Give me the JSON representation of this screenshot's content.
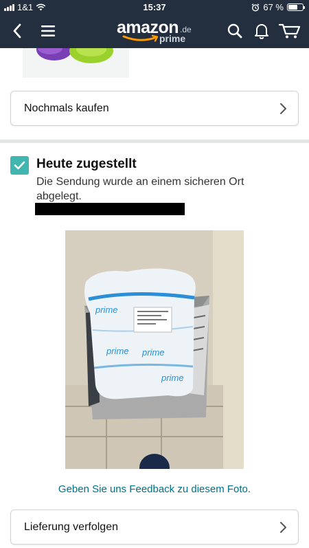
{
  "status_bar": {
    "carrier": "1&1",
    "time": "15:37",
    "battery_text": "67 %",
    "battery_level": 0.67,
    "icons": [
      "signal-icon",
      "wifi-icon",
      "alarm-icon",
      "battery-icon"
    ]
  },
  "nav": {
    "logo_main": "amazon",
    "logo_suffix": ".de",
    "logo_sub": "prime",
    "icons": [
      "back-icon",
      "menu-icon",
      "search-icon",
      "bell-icon",
      "cart-icon"
    ]
  },
  "buy_again": {
    "label": "Nochmals kaufen"
  },
  "delivery": {
    "title": "Heute zugestellt",
    "description": "Die Sendung wurde an einem sicheren Ort abgelegt.",
    "feedback_link": "Geben Sie uns Feedback zu diesem Foto."
  },
  "photo": {
    "package_labels": [
      "prime",
      "prime",
      "prime",
      "prime",
      "prime"
    ]
  },
  "track": {
    "label": "Lieferung verfolgen"
  },
  "colors": {
    "nav_bg": "#232f3e",
    "check_accent": "#41b5b0",
    "link": "#007185",
    "logo_smile": "#ff9900"
  }
}
